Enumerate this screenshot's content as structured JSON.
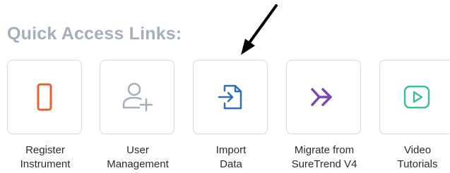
{
  "section": {
    "title": "Quick Access Links:"
  },
  "quick_links": [
    {
      "label_line1": "Register",
      "label_line2": "Instrument",
      "icon": "tablet-icon",
      "icon_color": "#e4612f"
    },
    {
      "label_line1": "User",
      "label_line2": "Management",
      "icon": "add-user-icon",
      "icon_color": "#a3adbd"
    },
    {
      "label_line1": "Import",
      "label_line2": "Data",
      "icon": "file-import-icon",
      "icon_color": "#2f6fb6"
    },
    {
      "label_line1": "Migrate from",
      "label_line2": "SureTrend V4",
      "icon": "double-chevron-right-icon",
      "icon_color": "#7b45b8"
    },
    {
      "label_line1": "Video",
      "label_line2": "Tutorials",
      "icon": "video-play-icon",
      "icon_color": "#3bbf95"
    }
  ],
  "annotation": {
    "icon": "pointer-arrow-icon",
    "color": "#000000"
  }
}
